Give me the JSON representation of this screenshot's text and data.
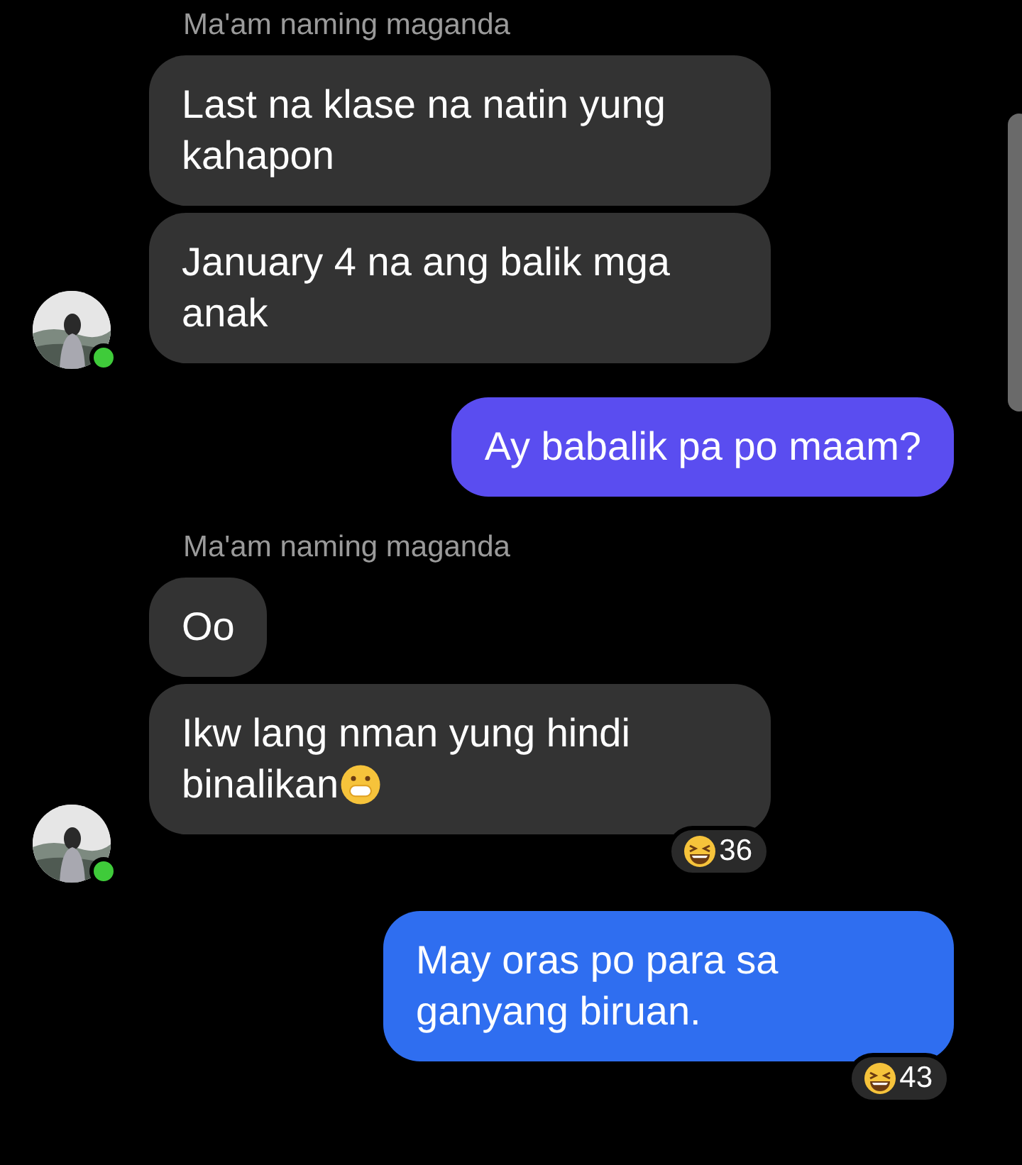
{
  "groups": [
    {
      "kind": "incoming",
      "sender": "Ma'am naming maganda",
      "online": true,
      "messages": [
        {
          "text": "Last na klase na natin yung kahapon"
        },
        {
          "text": "January 4 na ang balik mga anak"
        }
      ]
    },
    {
      "kind": "outgoing",
      "messages": [
        {
          "text": "Ay babalik pa po maam?",
          "color": "#5a4df0"
        }
      ]
    },
    {
      "kind": "incoming",
      "sender": "Ma'am naming maganda",
      "online": true,
      "messages": [
        {
          "text": "Oo"
        },
        {
          "text": "Ikw lang nman yung hindi binalikan",
          "emoji": true,
          "reaction": "36"
        }
      ]
    },
    {
      "kind": "outgoing",
      "messages": [
        {
          "text": "May oras po para sa ganyang biruan.",
          "color": "#2f6ef0",
          "reaction": "43"
        }
      ]
    }
  ]
}
